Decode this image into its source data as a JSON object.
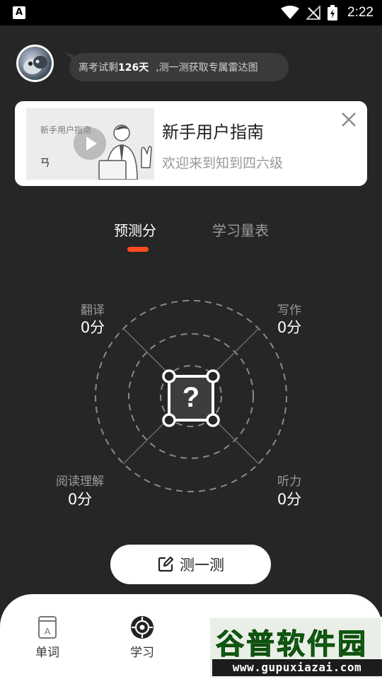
{
  "status_bar": {
    "app_icon": "A",
    "time": "2:22",
    "icons": [
      "wifi-icon",
      "no-signal-icon",
      "battery-charging-icon"
    ]
  },
  "header": {
    "countdown_prefix": "离考试剩",
    "countdown_value": "126天",
    "countdown_suffix": ",测一测获取专属雷达图"
  },
  "guide_card": {
    "thumbnail_text": "新手用户指南",
    "thumbnail_logo": "ㄢ",
    "title": "新手用户指南",
    "subtitle": "欢迎来到知到四六级"
  },
  "tabs": [
    {
      "label": "预测分",
      "active": true
    },
    {
      "label": "学习量表",
      "active": false
    }
  ],
  "radar": {
    "center_icon": "?",
    "skills": [
      {
        "label": "翻译",
        "score": "0分"
      },
      {
        "label": "写作",
        "score": "0分"
      },
      {
        "label": "阅读理解",
        "score": "0分"
      },
      {
        "label": "听力",
        "score": "0分"
      }
    ]
  },
  "test_button": {
    "label": "测一测"
  },
  "bottom_nav": [
    {
      "label": "单词",
      "icon": "book-icon"
    },
    {
      "label": "学习",
      "icon": "target-icon"
    }
  ],
  "watermark": {
    "title": "谷普软件园",
    "url": "www.gupuxiazai.com"
  },
  "colors": {
    "background": "#262626",
    "accent": "#ff4b1f",
    "card": "#ffffff"
  }
}
